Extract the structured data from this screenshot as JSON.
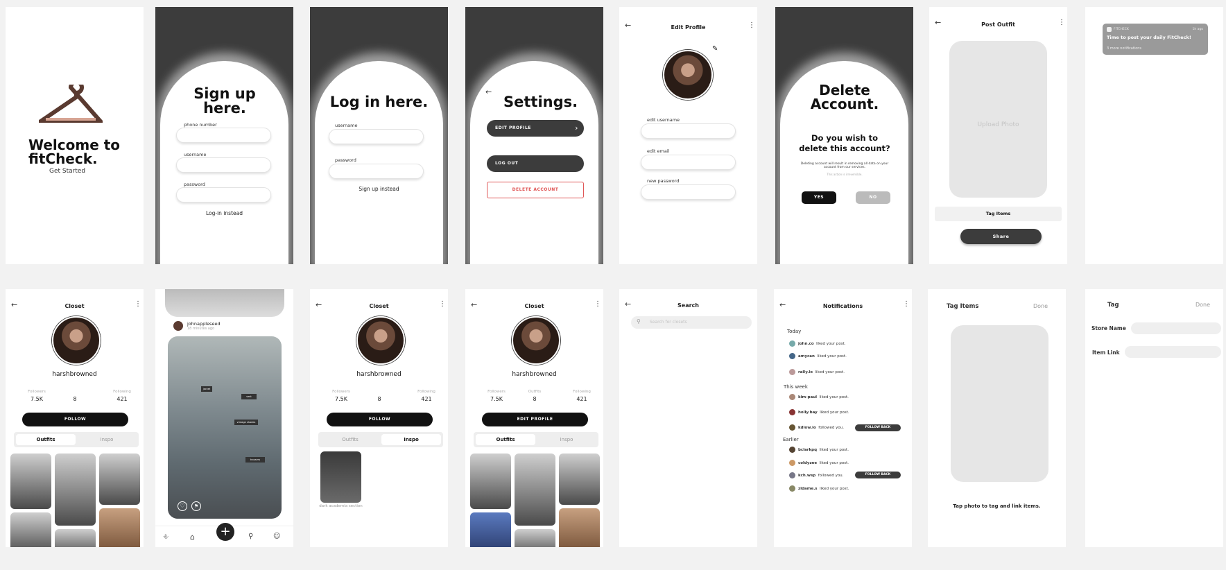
{
  "welcome": {
    "title": "Welcome to fitCheck.",
    "cta": "Get Started"
  },
  "signup": {
    "title": "Sign up here.",
    "phone_label": "phone number",
    "username_label": "username",
    "password_label": "password",
    "link": "Log-in instead"
  },
  "login": {
    "title": "Log in here.",
    "username_label": "username",
    "password_label": "password",
    "link": "Sign up instead"
  },
  "settings": {
    "title": "Settings.",
    "edit_profile": "EDIT PROFILE",
    "logout": "LOG OUT",
    "delete": "DELETE ACCOUNT"
  },
  "edit_profile": {
    "title": "Edit Profile",
    "username_label": "edit username",
    "email_label": "edit email",
    "password_label": "new password"
  },
  "delete": {
    "title": "Delete Account.",
    "question": "Do you wish to delete this account?",
    "body": "Deleting account will result in removing all data on your account from our services.",
    "note": "This action is irreversible.",
    "yes": "YES",
    "no": "NO"
  },
  "post": {
    "title": "Post Outfit",
    "upload": "Upload Photo",
    "tag": "Tag Items",
    "share": "Share"
  },
  "push": {
    "app": "FITCHECK",
    "time": "1h ago",
    "message": "Time to post your daily FitCheck!",
    "more": "3 more notifications"
  },
  "closet": {
    "title": "Closet",
    "username": "harshbrowned",
    "followers_label": "Followers",
    "followers": "7.5K",
    "outfits_label": "Outfits",
    "outfits": "8",
    "following_label": "Following",
    "following": "421",
    "follow": "FOLLOW",
    "edit": "EDIT PROFILE",
    "tab_outfits": "Outfits",
    "tab_inspo": "Inspo",
    "inspo_caption": "dark academia section"
  },
  "feed": {
    "user": "johnappleseed",
    "time": "18 minutes ago",
    "tags": [
      "jacket",
      "vest",
      "vintage shades",
      "trousers"
    ]
  },
  "search": {
    "title": "Search",
    "placeholder": "Search for closets"
  },
  "notifications": {
    "title": "Notifications",
    "sections": {
      "today": "Today",
      "week": "This week",
      "earlier": "Earlier"
    },
    "follow_back": "FOLLOW BACK",
    "today": [
      {
        "user": "john.co",
        "action": "liked your post."
      },
      {
        "user": "amycan",
        "action": "liked your post."
      },
      {
        "user": "rally.lo",
        "action": "liked your post."
      }
    ],
    "week": [
      {
        "user": "kim-paul",
        "action": "liked your post."
      },
      {
        "user": "holly.bay",
        "action": "liked your post."
      },
      {
        "user": "kdlow.io",
        "action": "followed you."
      }
    ],
    "earlier": [
      {
        "user": "bclarkpq",
        "action": "liked your post."
      },
      {
        "user": "coldyzee",
        "action": "liked your post."
      },
      {
        "user": "kch.wsp",
        "action": "followed you."
      },
      {
        "user": "zldame.s",
        "action": "liked your post."
      }
    ]
  },
  "tag_items": {
    "title": "Tag Items",
    "done": "Done",
    "hint": "Tap photo to tag and link items."
  },
  "tag": {
    "title": "Tag",
    "done": "Done",
    "store": "Store Name",
    "link": "Item Link"
  },
  "colors": {
    "dark": "#3c3c3c",
    "red": "#e05555",
    "bg": "#f2f2f2"
  }
}
